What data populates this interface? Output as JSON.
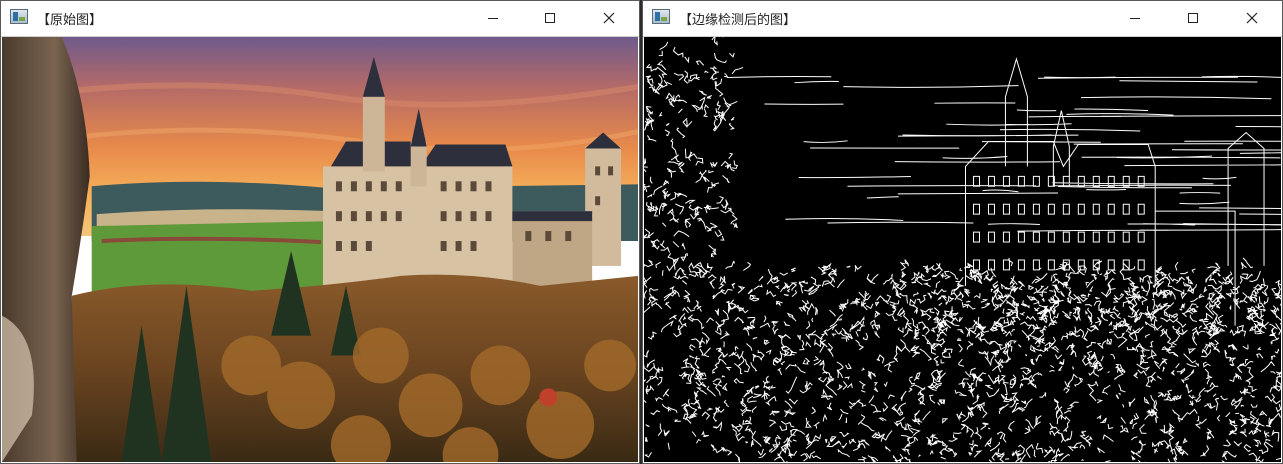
{
  "windows": [
    {
      "title": "【原始图】",
      "icon": "opencv-window-icon",
      "controls": [
        "minimize-icon",
        "maximize-icon",
        "close-icon"
      ],
      "content": "photo-castle"
    },
    {
      "title": "【边缘检测后的图】",
      "icon": "opencv-window-icon",
      "controls": [
        "minimize-icon",
        "maximize-icon",
        "close-icon"
      ],
      "content": "edge-map-castle"
    }
  ],
  "colors": {
    "sky_top": "#6f5a8c",
    "sky_mid": "#e7894a",
    "sky_low": "#f6b25a",
    "castle": "#d8c2a4",
    "roof": "#2d2f3c",
    "forest": "#5a3a1e",
    "meadow": "#5f9a3a",
    "lake": "#c9b38a",
    "edge_bg": "#000000",
    "edge_line": "#ffffff"
  }
}
